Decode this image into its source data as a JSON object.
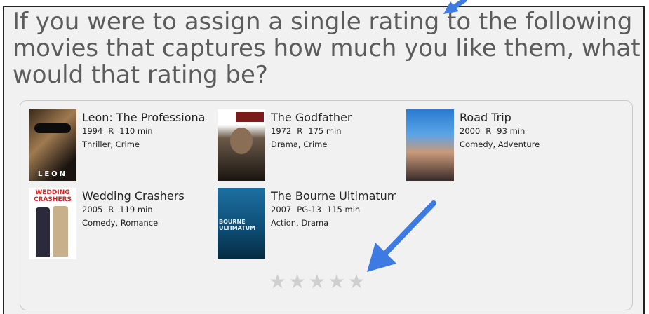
{
  "question": "If you were to assign a single rating to the following movies that captures how much you like them, what would that rating be?",
  "movies": [
    {
      "title": "Leon: The Professiona",
      "year": "1994",
      "rating": "R",
      "runtime": "110 min",
      "genres": "Thriller, Crime",
      "poster_text": "LEON"
    },
    {
      "title": "The Godfather",
      "year": "1972",
      "rating": "R",
      "runtime": "175 min",
      "genres": "Drama, Crime"
    },
    {
      "title": "Road Trip",
      "year": "2000",
      "rating": "R",
      "runtime": "93 min",
      "genres": "Comedy, Adventure"
    },
    {
      "title": "Wedding Crashers",
      "year": "2005",
      "rating": "R",
      "runtime": "119 min",
      "genres": "Comedy, Romance",
      "poster_text": "WEDDING CRASHERS"
    },
    {
      "title": "The Bourne Ultimatum",
      "year": "2007",
      "rating": "PG-13",
      "runtime": "115 min",
      "genres": "Action, Drama",
      "poster_text": "BOURNE ULTIMATUM"
    }
  ],
  "rating_widget": {
    "stars": 5,
    "selected": 0
  },
  "colors": {
    "arrow": "#3d7be3",
    "star_empty": "#cfcfcf",
    "question_text": "#5c5c5c"
  }
}
